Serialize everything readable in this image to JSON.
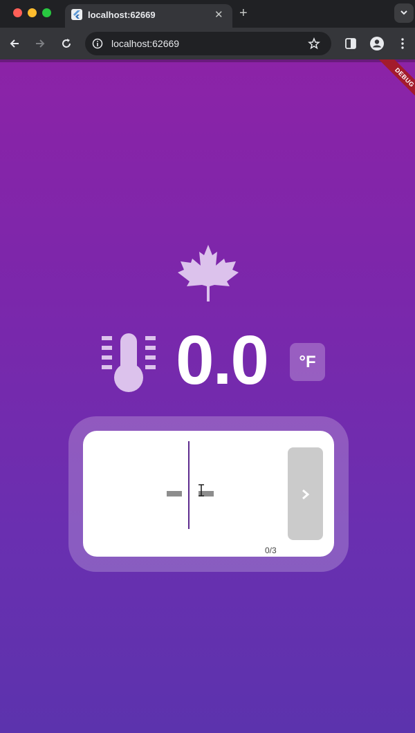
{
  "browser": {
    "tab_title": "localhost:62669",
    "tab_close": "✕",
    "new_tab": "+",
    "url": "localhost:62669"
  },
  "app": {
    "debug_banner": "DEBUG",
    "temperature": "0.0",
    "unit": "°F",
    "counter": "0/3",
    "icons": [
      "maple-leaf-icon",
      "thermometer-icon",
      "chevron-right-icon"
    ],
    "colors": {
      "gradient_top": "#8c23a7",
      "gradient_bottom": "#5c33ad",
      "card": "#ffffff",
      "cursor": "#5e2b8e",
      "next_button": "#cbcbcb",
      "debug_ribbon": "#a31b2c"
    }
  }
}
